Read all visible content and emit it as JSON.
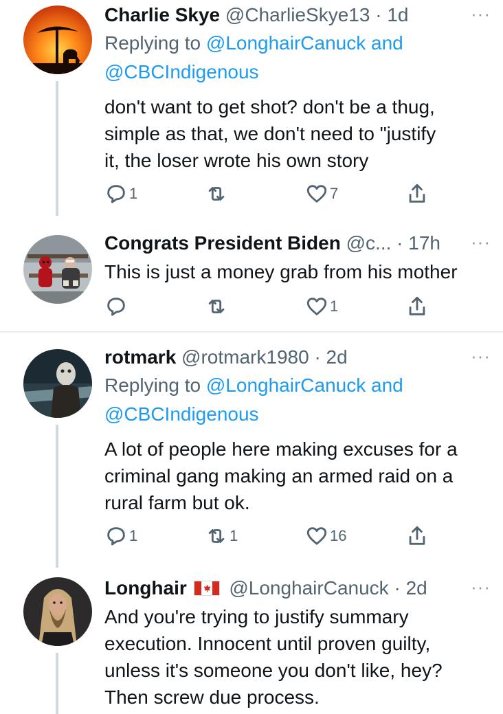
{
  "tweets": [
    {
      "name": "Charlie Skye",
      "handle": "@CharlieSkye13",
      "dot": "·",
      "time": "1d",
      "more": "···",
      "replying_prefix": "Replying to ",
      "replying_user1": "@LonghairCanuck",
      "replying_and": " and",
      "replying_user2": "@CBCIndigenous",
      "text_lines": [
        "don't want to get shot?  don't be a thug,",
        "simple as that, we don't need to \"justify",
        "it, the loser wrote his own story"
      ],
      "reply_count": "1",
      "retweet_count": "",
      "like_count": "7",
      "avatar_icon": "sunset-elephant-avatar"
    },
    {
      "name": "Congrats President Biden",
      "handle": "@c...",
      "dot": "·",
      "time": "17h",
      "more": "···",
      "text_lines": [
        "This is just a money grab from his mother"
      ],
      "reply_count": "",
      "retweet_count": "",
      "like_count": "1",
      "avatar_icon": "deadpool-bernie-avatar"
    },
    {
      "name": "rotmark",
      "handle": "@rotmark1980",
      "dot": "·",
      "time": "2d",
      "more": "···",
      "replying_prefix": "Replying to ",
      "replying_user1": "@LonghairCanuck",
      "replying_and": " and",
      "replying_user2": "@CBCIndigenous",
      "text_lines": [
        "A lot of people here making excuses for a",
        "criminal gang making an armed raid on a",
        "rural farm but ok."
      ],
      "reply_count": "1",
      "retweet_count": "1",
      "like_count": "16",
      "avatar_icon": "hockey-mask-avatar"
    },
    {
      "name": "Longhair",
      "handle": "@LonghairCanuck",
      "dot": "·",
      "time": "2d",
      "more": "···",
      "text_lines": [
        "And you're trying to justify summary",
        "execution. Innocent until proven guilty,",
        "unless it's someone you don't like, hey?",
        "Then screw due process."
      ],
      "flag_icon": "canada-flag-icon",
      "avatar_icon": "long-hair-man-avatar"
    }
  ],
  "colors": {
    "link": "#1d9bf0",
    "secondary": "#536471",
    "thread_line": "#cfd9de",
    "divider": "#e6ecf0"
  }
}
